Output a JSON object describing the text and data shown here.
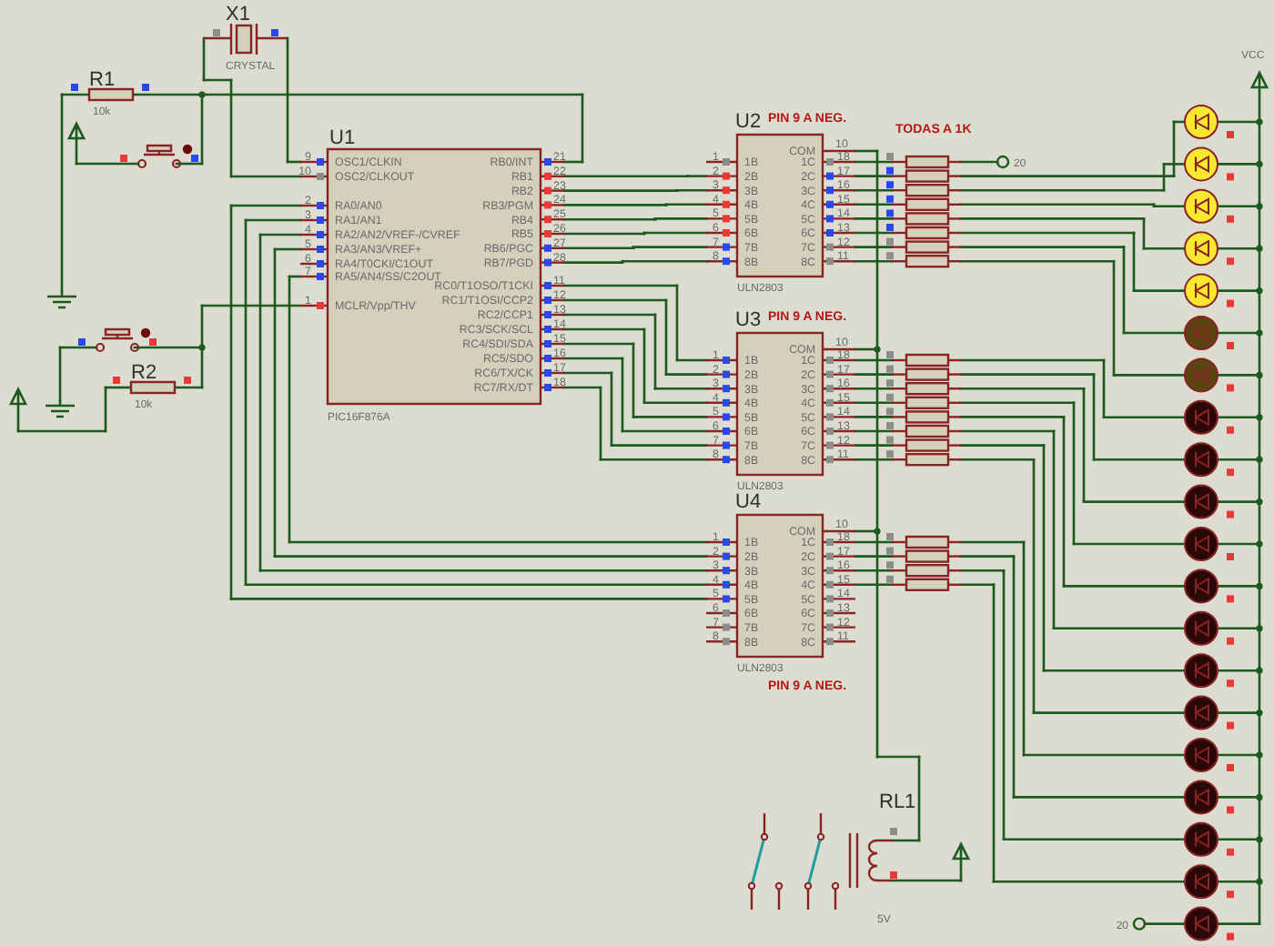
{
  "crystal": {
    "ref": "X1",
    "value": "CRYSTAL",
    "pins": [
      {
        "color": "#8c8c8c"
      },
      {
        "color": "#2848f0"
      }
    ]
  },
  "resistors": [
    {
      "ref": "R1",
      "value": "10k",
      "pins": [
        {
          "color": "#2848f0"
        },
        {
          "color": "#2848f0"
        }
      ]
    },
    {
      "ref": "R2",
      "value": "10k",
      "pins": [
        {
          "color": "#e83838"
        },
        {
          "color": "#e83838"
        }
      ]
    }
  ],
  "buttons": [
    {
      "pins": [
        {
          "color": "#e83838"
        },
        {
          "color": "#2848f0"
        }
      ]
    },
    {
      "pins": [
        {
          "color": "#2848f0"
        },
        {
          "color": "#e83838"
        }
      ]
    }
  ],
  "mcu": {
    "ref": "U1",
    "part": "PIC16F876A",
    "left_pins": [
      {
        "number": "9",
        "name": "OSC1/CLKIN",
        "color": "#2848f0"
      },
      {
        "number": "10",
        "name": "OSC2/CLKOUT",
        "color": "#8c8c8c"
      },
      {
        "number": "2",
        "name": "RA0/AN0",
        "color": "#2848f0"
      },
      {
        "number": "3",
        "name": "RA1/AN1",
        "color": "#2848f0"
      },
      {
        "number": "4",
        "name": "RA2/AN2/VREF-/CVREF",
        "color": "#2848f0"
      },
      {
        "number": "5",
        "name": "RA3/AN3/VREF+",
        "color": "#2848f0"
      },
      {
        "number": "6",
        "name": "RA4/T0CKI/C1OUT",
        "color": "#2848f0"
      },
      {
        "number": "7",
        "name": "RA5/AN4/SS/C2OUT",
        "color": "#2848f0"
      },
      {
        "number": "1",
        "name": "MCLR/Vpp/THV",
        "color": "#e83838"
      }
    ],
    "right_pins": [
      {
        "number": "21",
        "name": "RB0/INT",
        "color": "#2848f0"
      },
      {
        "number": "22",
        "name": "RB1",
        "color": "#e83838"
      },
      {
        "number": "23",
        "name": "RB2",
        "color": "#e83838"
      },
      {
        "number": "24",
        "name": "RB3/PGM",
        "color": "#e83838"
      },
      {
        "number": "25",
        "name": "RB4",
        "color": "#e83838"
      },
      {
        "number": "26",
        "name": "RB5",
        "color": "#e83838"
      },
      {
        "number": "27",
        "name": "RB6/PGC",
        "color": "#2848f0"
      },
      {
        "number": "28",
        "name": "RB7/PGD",
        "color": "#2848f0"
      },
      {
        "number": "11",
        "name": "RC0/T1OSO/T1CKI",
        "color": "#2848f0"
      },
      {
        "number": "12",
        "name": "RC1/T1OSI/CCP2",
        "color": "#2848f0"
      },
      {
        "number": "13",
        "name": "RC2/CCP1",
        "color": "#2848f0"
      },
      {
        "number": "14",
        "name": "RC3/SCK/SCL",
        "color": "#2848f0"
      },
      {
        "number": "15",
        "name": "RC4/SDI/SDA",
        "color": "#2848f0"
      },
      {
        "number": "16",
        "name": "RC5/SDO",
        "color": "#2848f0"
      },
      {
        "number": "17",
        "name": "RC6/TX/CK",
        "color": "#2848f0"
      },
      {
        "number": "18",
        "name": "RC7/RX/DT",
        "color": "#2848f0"
      }
    ]
  },
  "drivers": [
    {
      "ref": "U2",
      "part": "ULN2803",
      "note": "PIN 9 A NEG.",
      "com": {
        "number": "10",
        "name": "COM"
      },
      "inputs": [
        {
          "number": "1",
          "name": "1B",
          "color": "#8c8c8c"
        },
        {
          "number": "2",
          "name": "2B",
          "color": "#e83838"
        },
        {
          "number": "3",
          "name": "3B",
          "color": "#e83838"
        },
        {
          "number": "4",
          "name": "4B",
          "color": "#e83838"
        },
        {
          "number": "5",
          "name": "5B",
          "color": "#e83838"
        },
        {
          "number": "6",
          "name": "6B",
          "color": "#e83838"
        },
        {
          "number": "7",
          "name": "7B",
          "color": "#2848f0"
        },
        {
          "number": "8",
          "name": "8B",
          "color": "#2848f0"
        }
      ],
      "outputs": [
        {
          "number": "18",
          "name": "1C",
          "color": "#8c8c8c"
        },
        {
          "number": "17",
          "name": "2C",
          "color": "#2848f0"
        },
        {
          "number": "16",
          "name": "3C",
          "color": "#2848f0"
        },
        {
          "number": "15",
          "name": "4C",
          "color": "#2848f0"
        },
        {
          "number": "14",
          "name": "5C",
          "color": "#2848f0"
        },
        {
          "number": "13",
          "name": "6C",
          "color": "#2848f0"
        },
        {
          "number": "12",
          "name": "7C",
          "color": "#8c8c8c"
        },
        {
          "number": "11",
          "name": "8C",
          "color": "#8c8c8c"
        }
      ]
    },
    {
      "ref": "U3",
      "part": "ULN2803",
      "note": "PIN 9 A NEG.",
      "com": {
        "number": "10",
        "name": "COM"
      },
      "inputs": [
        {
          "number": "1",
          "name": "1B",
          "color": "#2848f0"
        },
        {
          "number": "2",
          "name": "2B",
          "color": "#2848f0"
        },
        {
          "number": "3",
          "name": "3B",
          "color": "#2848f0"
        },
        {
          "number": "4",
          "name": "4B",
          "color": "#2848f0"
        },
        {
          "number": "5",
          "name": "5B",
          "color": "#2848f0"
        },
        {
          "number": "6",
          "name": "6B",
          "color": "#2848f0"
        },
        {
          "number": "7",
          "name": "7B",
          "color": "#2848f0"
        },
        {
          "number": "8",
          "name": "8B",
          "color": "#2848f0"
        }
      ],
      "outputs": [
        {
          "number": "18",
          "name": "1C",
          "color": "#8c8c8c"
        },
        {
          "number": "17",
          "name": "2C",
          "color": "#8c8c8c"
        },
        {
          "number": "16",
          "name": "3C",
          "color": "#8c8c8c"
        },
        {
          "number": "15",
          "name": "4C",
          "color": "#8c8c8c"
        },
        {
          "number": "14",
          "name": "5C",
          "color": "#8c8c8c"
        },
        {
          "number": "13",
          "name": "6C",
          "color": "#8c8c8c"
        },
        {
          "number": "12",
          "name": "7C",
          "color": "#8c8c8c"
        },
        {
          "number": "11",
          "name": "8C",
          "color": "#8c8c8c"
        }
      ]
    },
    {
      "ref": "U4",
      "part": "ULN2803",
      "note": "PIN 9 A NEG.",
      "com": {
        "number": "10",
        "name": "COM"
      },
      "inputs": [
        {
          "number": "1",
          "name": "1B",
          "color": "#2848f0"
        },
        {
          "number": "2",
          "name": "2B",
          "color": "#2848f0"
        },
        {
          "number": "3",
          "name": "3B",
          "color": "#2848f0"
        },
        {
          "number": "4",
          "name": "4B",
          "color": "#2848f0"
        },
        {
          "number": "5",
          "name": "5B",
          "color": "#2848f0"
        },
        {
          "number": "6",
          "name": "6B",
          "color": "#8c8c8c"
        },
        {
          "number": "7",
          "name": "7B",
          "color": "#8c8c8c"
        },
        {
          "number": "8",
          "name": "8B",
          "color": "#8c8c8c"
        }
      ],
      "outputs": [
        {
          "number": "18",
          "name": "1C",
          "color": "#8c8c8c"
        },
        {
          "number": "17",
          "name": "2C",
          "color": "#8c8c8c"
        },
        {
          "number": "16",
          "name": "3C",
          "color": "#8c8c8c"
        },
        {
          "number": "15",
          "name": "4C",
          "color": "#8c8c8c"
        },
        {
          "number": "14",
          "name": "5C",
          "color": "#8c8c8c"
        },
        {
          "number": "13",
          "name": "6C",
          "color": "#8c8c8c"
        },
        {
          "number": "12",
          "name": "7C",
          "color": "#8c8c8c"
        },
        {
          "number": "11",
          "name": "8C",
          "color": "#8c8c8c"
        }
      ]
    }
  ],
  "array_label": "TODAS A 1K",
  "arrays": [
    {
      "resistors": [
        {
          "color": "#8c8c8c"
        },
        {
          "color": "#2848f0"
        },
        {
          "color": "#2848f0"
        },
        {
          "color": "#2848f0"
        },
        {
          "color": "#2848f0"
        },
        {
          "color": "#2848f0"
        },
        {
          "color": "#8c8c8c"
        },
        {
          "color": "#8c8c8c"
        }
      ]
    },
    {
      "resistors": [
        {
          "color": "#8c8c8c"
        },
        {
          "color": "#8c8c8c"
        },
        {
          "color": "#8c8c8c"
        },
        {
          "color": "#8c8c8c"
        },
        {
          "color": "#8c8c8c"
        },
        {
          "color": "#8c8c8c"
        },
        {
          "color": "#8c8c8c"
        },
        {
          "color": "#8c8c8c"
        }
      ]
    },
    {
      "resistors": [
        {
          "color": "#8c8c8c"
        },
        {
          "color": "#8c8c8c"
        },
        {
          "color": "#8c8c8c"
        },
        {
          "color": "#8c8c8c"
        }
      ]
    }
  ],
  "terminals": [
    {
      "label": "20"
    },
    {
      "label": "20"
    }
  ],
  "vcc": {
    "label": "VCC"
  },
  "leds": [
    {
      "color": "#f8e830"
    },
    {
      "color": "#f8e830"
    },
    {
      "color": "#f8e830"
    },
    {
      "color": "#f8e830"
    },
    {
      "color": "#f8e830"
    },
    {
      "color": "#5a4410"
    },
    {
      "color": "#5a4410"
    },
    {
      "color": "#2a0808"
    },
    {
      "color": "#2a0808"
    },
    {
      "color": "#2a0808"
    },
    {
      "color": "#2a0808"
    },
    {
      "color": "#2a0808"
    },
    {
      "color": "#2a0808"
    },
    {
      "color": "#2a0808"
    },
    {
      "color": "#2a0808"
    },
    {
      "color": "#2a0808"
    },
    {
      "color": "#2a0808"
    },
    {
      "color": "#2a0808"
    },
    {
      "color": "#2a0808"
    },
    {
      "color": "#2a0808"
    }
  ],
  "relay": {
    "ref": "RL1",
    "value": "5V",
    "pins": [
      {
        "color": "#8c8c8c"
      },
      {
        "color": "#e83838"
      }
    ]
  }
}
